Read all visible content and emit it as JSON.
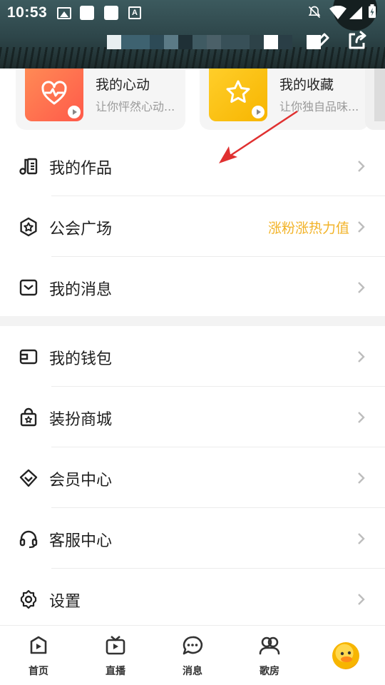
{
  "status_bar": {
    "time": "10:53"
  },
  "cards": [
    {
      "title": "我的心动",
      "subtitle": "让你怦然心动...",
      "thumb_color": "#ff6f4d",
      "icon": "heart-pulse-icon"
    },
    {
      "title": "我的收藏",
      "subtitle": "让你独自品味...",
      "thumb_color": "#ffc21a",
      "icon": "star-icon"
    }
  ],
  "menu_top": [
    {
      "label": "我的作品",
      "icon": "music-list-icon",
      "extra": ""
    },
    {
      "label": "公会广场",
      "icon": "guild-hexagon-icon",
      "extra": "涨粉涨热力值"
    },
    {
      "label": "我的消息",
      "icon": "mail-icon",
      "extra": ""
    }
  ],
  "menu_bottom": [
    {
      "label": "我的钱包",
      "icon": "wallet-icon"
    },
    {
      "label": "装扮商城",
      "icon": "shop-bag-icon"
    },
    {
      "label": "会员中心",
      "icon": "vip-diamond-icon"
    },
    {
      "label": "客服中心",
      "icon": "headset-icon"
    },
    {
      "label": "设置",
      "icon": "gear-icon"
    }
  ],
  "tabbar": [
    {
      "label": "首页",
      "icon": "home-play-icon"
    },
    {
      "label": "直播",
      "icon": "tv-icon"
    },
    {
      "label": "消息",
      "icon": "chat-icon"
    },
    {
      "label": "歌房",
      "icon": "users-icon"
    }
  ],
  "colors": {
    "accent_text": "#f2b328",
    "annotation_arrow": "#e03030"
  }
}
